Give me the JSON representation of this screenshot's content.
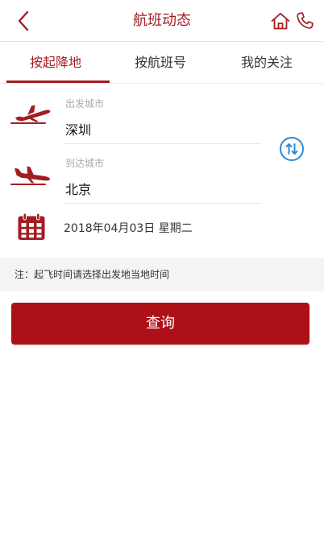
{
  "colors": {
    "brand": "#a31c22",
    "button": "#ad1118",
    "note_bg": "#f4f4f4"
  },
  "header": {
    "title": "航班动态",
    "back_icon": "chevron-left-icon",
    "home_icon": "home-icon",
    "phone_icon": "phone-icon"
  },
  "tabs": [
    {
      "label": "按起降地",
      "active": true
    },
    {
      "label": "按航班号",
      "active": false
    },
    {
      "label": "我的关注",
      "active": false
    }
  ],
  "form": {
    "departure": {
      "label": "出发城市",
      "value": "深圳",
      "icon": "plane-takeoff-icon"
    },
    "arrival": {
      "label": "到达城市",
      "value": "北京",
      "icon": "plane-landing-icon"
    },
    "swap_icon": "swap-vertical-icon",
    "date": {
      "value": "2018年04月03日 星期二",
      "icon": "calendar-icon"
    }
  },
  "note": "注：起飞时间请选择出发地当地时间",
  "query_button": "查询"
}
